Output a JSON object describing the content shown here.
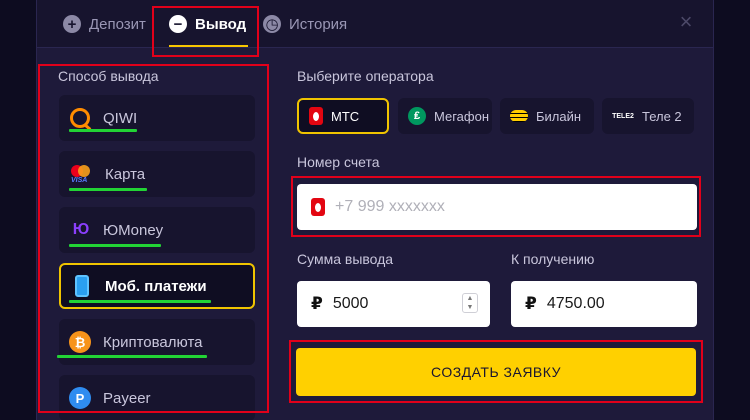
{
  "tabs": [
    {
      "label": "Депозит",
      "icon": "plus-icon"
    },
    {
      "label": "Вывод",
      "icon": "minus-icon"
    },
    {
      "label": "История",
      "icon": "clock-icon"
    }
  ],
  "withdraw_method": {
    "title": "Способ вывода",
    "items": [
      {
        "label": "QIWI",
        "icon": "qiwi-icon"
      },
      {
        "label": "Карта",
        "icon": "card-icon"
      },
      {
        "label": "ЮMoney",
        "icon": "yoomoney-icon"
      },
      {
        "label": "Моб. платежи",
        "icon": "phone-icon"
      },
      {
        "label": "Криптовалюта",
        "icon": "bitcoin-icon"
      },
      {
        "label": "Payeer",
        "icon": "payeer-icon"
      }
    ],
    "selected": "Моб. платежи"
  },
  "operator": {
    "title": "Выберите оператора",
    "items": [
      {
        "label": "МТС",
        "icon": "mts-icon"
      },
      {
        "label": "Мегафон",
        "icon": "megafon-icon"
      },
      {
        "label": "Билайн",
        "icon": "beeline-icon"
      },
      {
        "label": "Теле 2",
        "icon": "tele2-icon",
        "badge": "TELE2"
      }
    ],
    "selected": "МТС"
  },
  "account": {
    "label": "Номер счета",
    "placeholder": "+7 999 xxxxxxx"
  },
  "amount": {
    "label": "Сумма вывода",
    "currency": "₽",
    "value": "5000"
  },
  "receive": {
    "label": "К получению",
    "currency": "₽",
    "value": "4750.00"
  },
  "submit_label": "СОЗДАТЬ ЗАЯВКУ",
  "colors": {
    "accent": "#ffd000",
    "highlight": "#e1001a",
    "underline": "#22d335",
    "panel": "#1e1a3a"
  }
}
